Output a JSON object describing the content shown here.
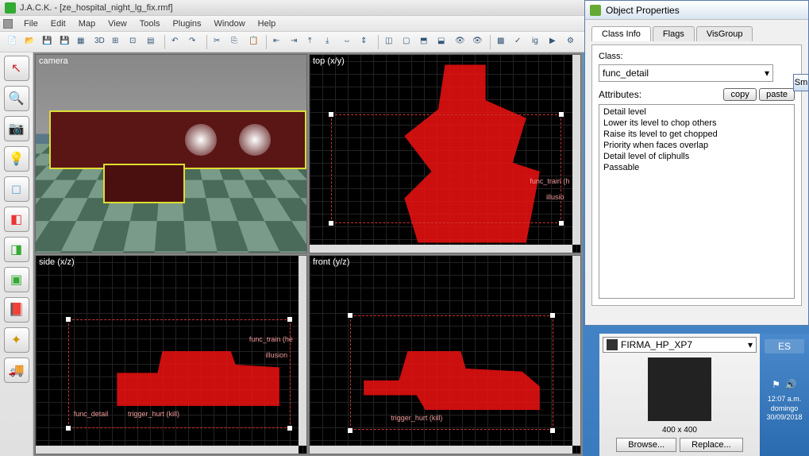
{
  "app": {
    "title": "J.A.C.K. - [ze_hospital_night_lg_fix.rmf]"
  },
  "menu": [
    "File",
    "Edit",
    "Map",
    "View",
    "Tools",
    "Plugins",
    "Window",
    "Help"
  ],
  "toolbar_icons": [
    "new",
    "open",
    "save",
    "save-all",
    "grid",
    "3d",
    "snap",
    "snap2",
    "wireframe",
    "sep",
    "undo",
    "redo",
    "sep",
    "cut",
    "copy",
    "paste",
    "sep",
    "align-l",
    "align-r",
    "align-t",
    "align-b",
    "flip-h",
    "flip-v",
    "sep",
    "carve",
    "hollow",
    "group",
    "ungroup",
    "hide",
    "show",
    "sep",
    "texture",
    "check",
    "ig",
    "run",
    "options"
  ],
  "tools": [
    {
      "name": "select-tool",
      "color": "#c33",
      "glyph": "↖"
    },
    {
      "name": "magnify-tool",
      "color": "#c33",
      "glyph": "🔍"
    },
    {
      "name": "camera-tool",
      "color": "#c33",
      "glyph": "📷"
    },
    {
      "name": "entity-tool",
      "color": "#9cd",
      "glyph": "💡"
    },
    {
      "name": "block-tool",
      "color": "#6ad",
      "glyph": "◻"
    },
    {
      "name": "texture-tool",
      "color": "#e33",
      "glyph": "◧"
    },
    {
      "name": "apply-tool",
      "color": "#3a3",
      "glyph": "◨"
    },
    {
      "name": "decal-tool",
      "color": "#3a3",
      "glyph": "▣"
    },
    {
      "name": "clip-tool",
      "color": "#d33",
      "glyph": "📕"
    },
    {
      "name": "vertex-tool",
      "color": "#c90",
      "glyph": "✦"
    },
    {
      "name": "path-tool",
      "color": "#4a4",
      "glyph": "🚚"
    }
  ],
  "viewports": {
    "camera": "camera",
    "top": "top (x/y)",
    "side": "side (x/z)",
    "front": "front (y/z)"
  },
  "wire_labels": {
    "top": [
      "func_train (h",
      "illusio"
    ],
    "side": [
      "func_train (he",
      "illusion",
      "func_detail",
      "trigger_hurt (kill)"
    ],
    "front": [
      "trigger_hurt (kill)"
    ]
  },
  "props": {
    "title": "Object Properties",
    "tabs": [
      "Class Info",
      "Flags",
      "VisGroup"
    ],
    "class_label": "Class:",
    "class_value": "func_detail",
    "sm_btn": "Sm",
    "attributes_label": "Attributes:",
    "copy_btn": "copy",
    "paste_btn": "paste",
    "attributes": [
      "Detail level",
      "Lower its level to chop others",
      "Raise its level to get chopped",
      "Priority when faces overlap",
      "Detail level of cliphulls",
      "Passable"
    ]
  },
  "texture": {
    "name": "FIRMA_HP_XP7",
    "size": "400 x 400",
    "browse": "Browse...",
    "replace": "Replace..."
  },
  "systray": {
    "lang": "ES",
    "time": "12:07 a.m.",
    "day": "domingo",
    "date": "30/09/2018"
  }
}
